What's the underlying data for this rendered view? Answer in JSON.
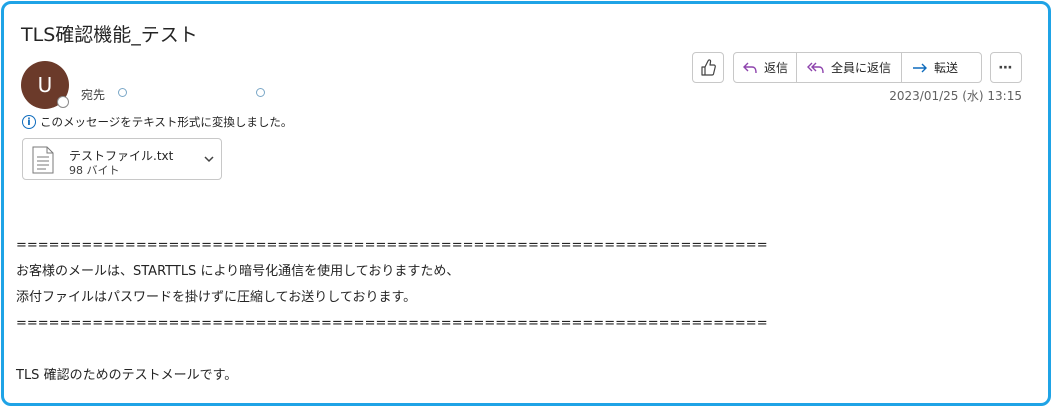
{
  "message": {
    "subject": "TLS確認機能_テスト",
    "sender_initial": "U",
    "to_label": "宛先",
    "info_banner": "このメッセージをテキスト形式に変換しました。",
    "date": "2023/01/25 (水) 13:15"
  },
  "attachment": {
    "name": "テストファイル.txt",
    "size": "98 バイト"
  },
  "actions": {
    "reply": "返信",
    "reply_all": "全員に返信",
    "forward": "転送"
  },
  "body": {
    "rule1": "=====================================================================",
    "line1": "お客様のメールは、STARTTLS により暗号化通信を使用しておりますため、",
    "line2": "添付ファイルはパスワードを掛けずに圧縮してお送りしております。",
    "rule2": "=====================================================================",
    "line3": "TLS 確認のためのテストメールです。"
  },
  "colors": {
    "frame": "#1fa3e6",
    "avatar": "#6b3a2a",
    "reply_icon": "#8e44ad",
    "forward_icon": "#0f6cbd"
  }
}
